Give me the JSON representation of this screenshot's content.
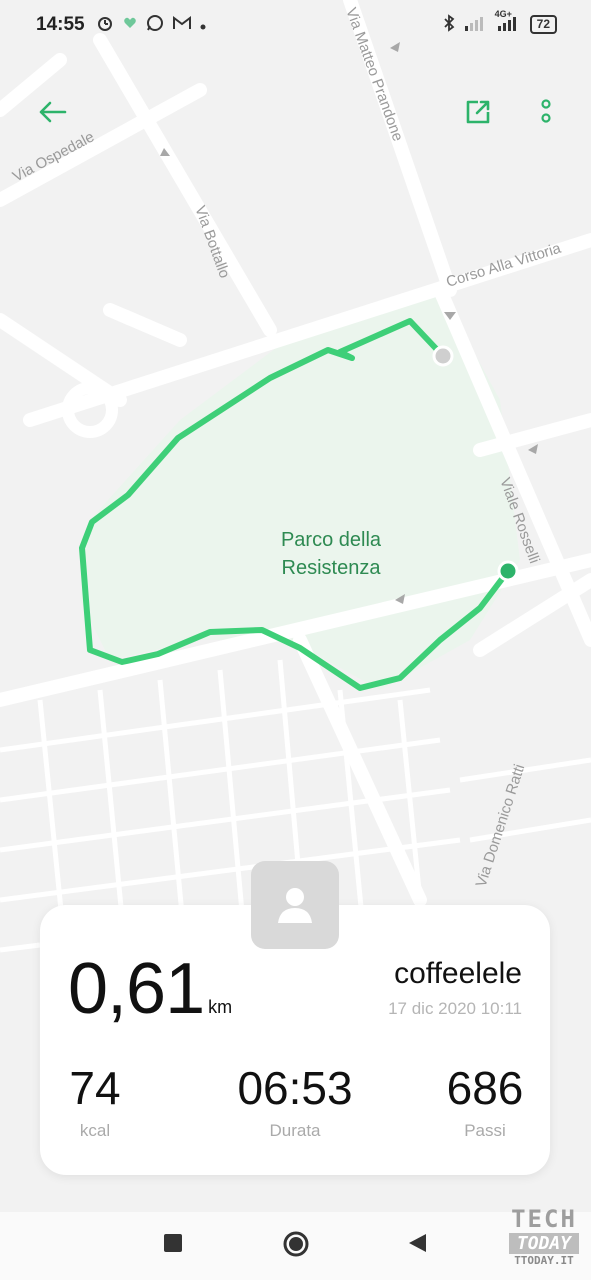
{
  "status_bar": {
    "time": "14:55",
    "battery": "72",
    "network": "4G+",
    "left_icons": [
      "alarm-icon",
      "heart-icon",
      "whatsapp-icon",
      "gmail-icon",
      "dot-icon"
    ],
    "right_icons": [
      "bluetooth-icon",
      "signal-icon",
      "signal-4g-icon",
      "battery-icon"
    ]
  },
  "toolbar": {
    "back_icon": "arrow-left-icon",
    "share_icon": "share-icon",
    "more_icon": "more-vertical-icon",
    "accent_color": "#2db36a"
  },
  "map": {
    "park_label_line1": "Parco della",
    "park_label_line2": "Resistenza",
    "streets": [
      "Via Ospedale",
      "Via Bottallo",
      "Via Matteo Prandone",
      "Corso Alla Vittoria",
      "Viale Rosselli",
      "Via Domenico Ratti"
    ],
    "route_color": "#3ecf78"
  },
  "activity": {
    "distance": "0,61",
    "distance_unit": "km",
    "user": "coffeelele",
    "date": "17 dic 2020 10:11",
    "stats": [
      {
        "value": "74",
        "label": "kcal"
      },
      {
        "value": "06:53",
        "label": "Durata"
      },
      {
        "value": "686",
        "label": "Passi"
      }
    ]
  },
  "navigation": {
    "recent_icon": "square-icon",
    "home_icon": "circle-icon",
    "back_icon": "triangle-back-icon"
  },
  "watermark": {
    "line1": "TECH",
    "line2": "TODAY",
    "line3": "TTODAY.IT"
  }
}
